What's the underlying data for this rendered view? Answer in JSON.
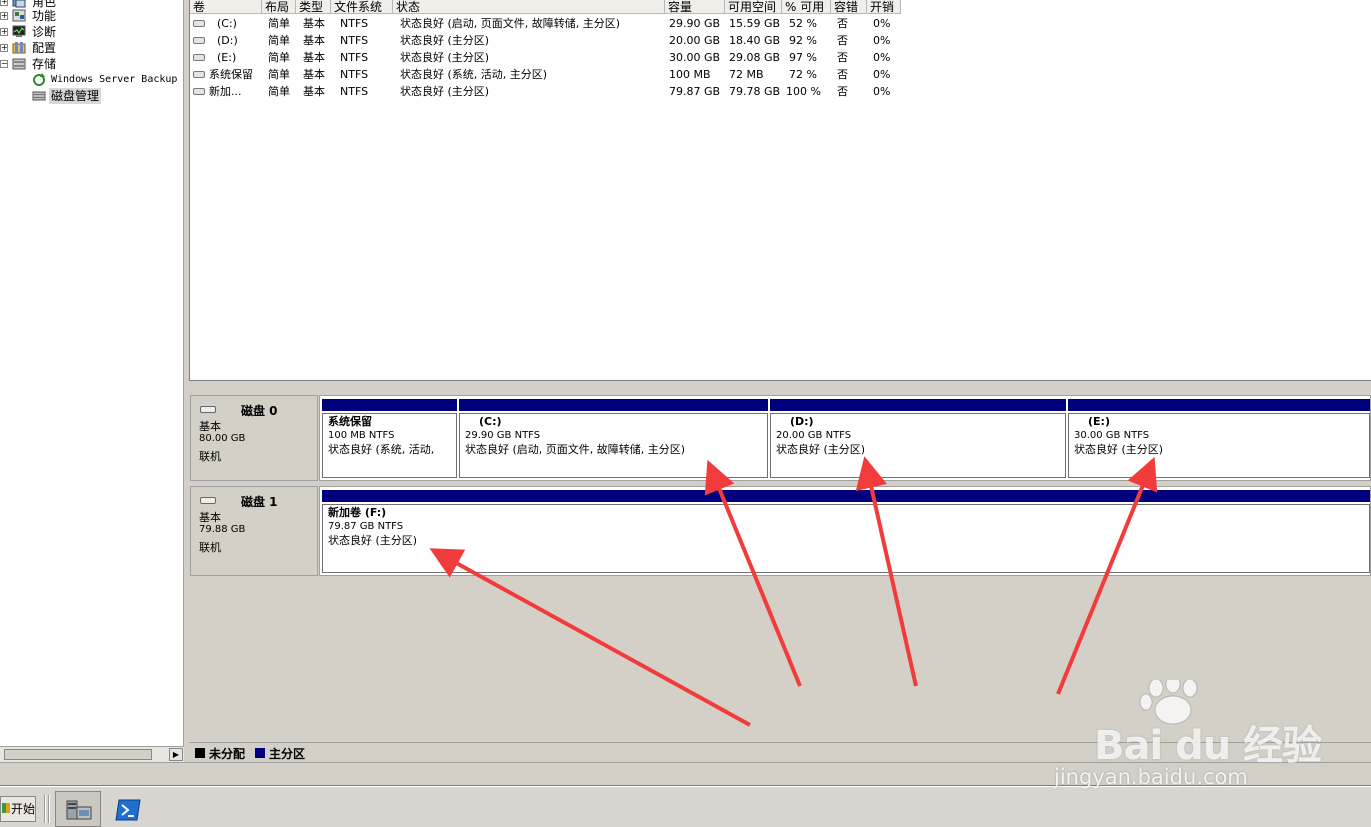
{
  "tree": {
    "items": [
      {
        "label": "角色",
        "icon": "roles-icon"
      },
      {
        "label": "功能",
        "icon": "features-icon"
      },
      {
        "label": "诊断",
        "icon": "diagnostics-icon"
      },
      {
        "label": "配置",
        "icon": "configuration-icon"
      },
      {
        "label": "存储",
        "icon": "storage-icon"
      },
      {
        "label": "Windows Server Backup",
        "icon": "backup-icon"
      },
      {
        "label": "磁盘管理",
        "icon": "disk-management-icon"
      }
    ]
  },
  "volume_list": {
    "columns": [
      "卷",
      "布局",
      "类型",
      "文件系统",
      "状态",
      "容量",
      "可用空间",
      "% 可用",
      "容错",
      "开销"
    ],
    "rows": [
      [
        "(C:)",
        "简单",
        "基本",
        "NTFS",
        "状态良好 (启动, 页面文件, 故障转储, 主分区)",
        "29.90 GB",
        "15.59 GB",
        "52 %",
        "否",
        "0%"
      ],
      [
        "(D:)",
        "简单",
        "基本",
        "NTFS",
        "状态良好 (主分区)",
        "20.00 GB",
        "18.40 GB",
        "92 %",
        "否",
        "0%"
      ],
      [
        "(E:)",
        "简单",
        "基本",
        "NTFS",
        "状态良好 (主分区)",
        "30.00 GB",
        "29.08 GB",
        "97 %",
        "否",
        "0%"
      ],
      [
        "系统保留",
        "简单",
        "基本",
        "NTFS",
        "状态良好 (系统, 活动, 主分区)",
        "100 MB",
        "72 MB",
        "72 %",
        "否",
        "0%"
      ],
      [
        "新加...",
        "简单",
        "基本",
        "NTFS",
        "状态良好 (主分区)",
        "79.87 GB",
        "79.78 GB",
        "100 %",
        "否",
        "0%"
      ]
    ]
  },
  "disks": [
    {
      "title": "磁盘 0",
      "type": "基本",
      "size": "80.00 GB",
      "status": "联机",
      "partitions": [
        {
          "name": "系统保留",
          "size": "100 MB NTFS",
          "status": "状态良好 (系统, 活动,"
        },
        {
          "name": "(C:)",
          "size": "29.90 GB NTFS",
          "status": "状态良好 (启动, 页面文件, 故障转储, 主分区)"
        },
        {
          "name": "(D:)",
          "size": "20.00 GB NTFS",
          "status": "状态良好 (主分区)"
        },
        {
          "name": "(E:)",
          "size": "30.00 GB NTFS",
          "status": "状态良好 (主分区)"
        }
      ]
    },
    {
      "title": "磁盘 1",
      "type": "基本",
      "size": "79.88 GB",
      "status": "联机",
      "partitions": [
        {
          "name": "新加卷  (F:)",
          "size": "79.87 GB NTFS",
          "status": "状态良好 (主分区)"
        }
      ]
    }
  ],
  "legend": {
    "unallocated": "未分配",
    "primary": "主分区",
    "unallocated_color": "#000000",
    "primary_color": "#00007f"
  },
  "taskbar": {
    "start_label": "开始",
    "buttons": [
      {
        "icon": "server-manager-icon",
        "active": true
      },
      {
        "icon": "powershell-icon",
        "active": false
      }
    ]
  },
  "annotation": {
    "arrow_color": "#f23c3c"
  },
  "watermark": {
    "logo": "Bai du 经验",
    "url": "jingyan.baidu.com"
  }
}
